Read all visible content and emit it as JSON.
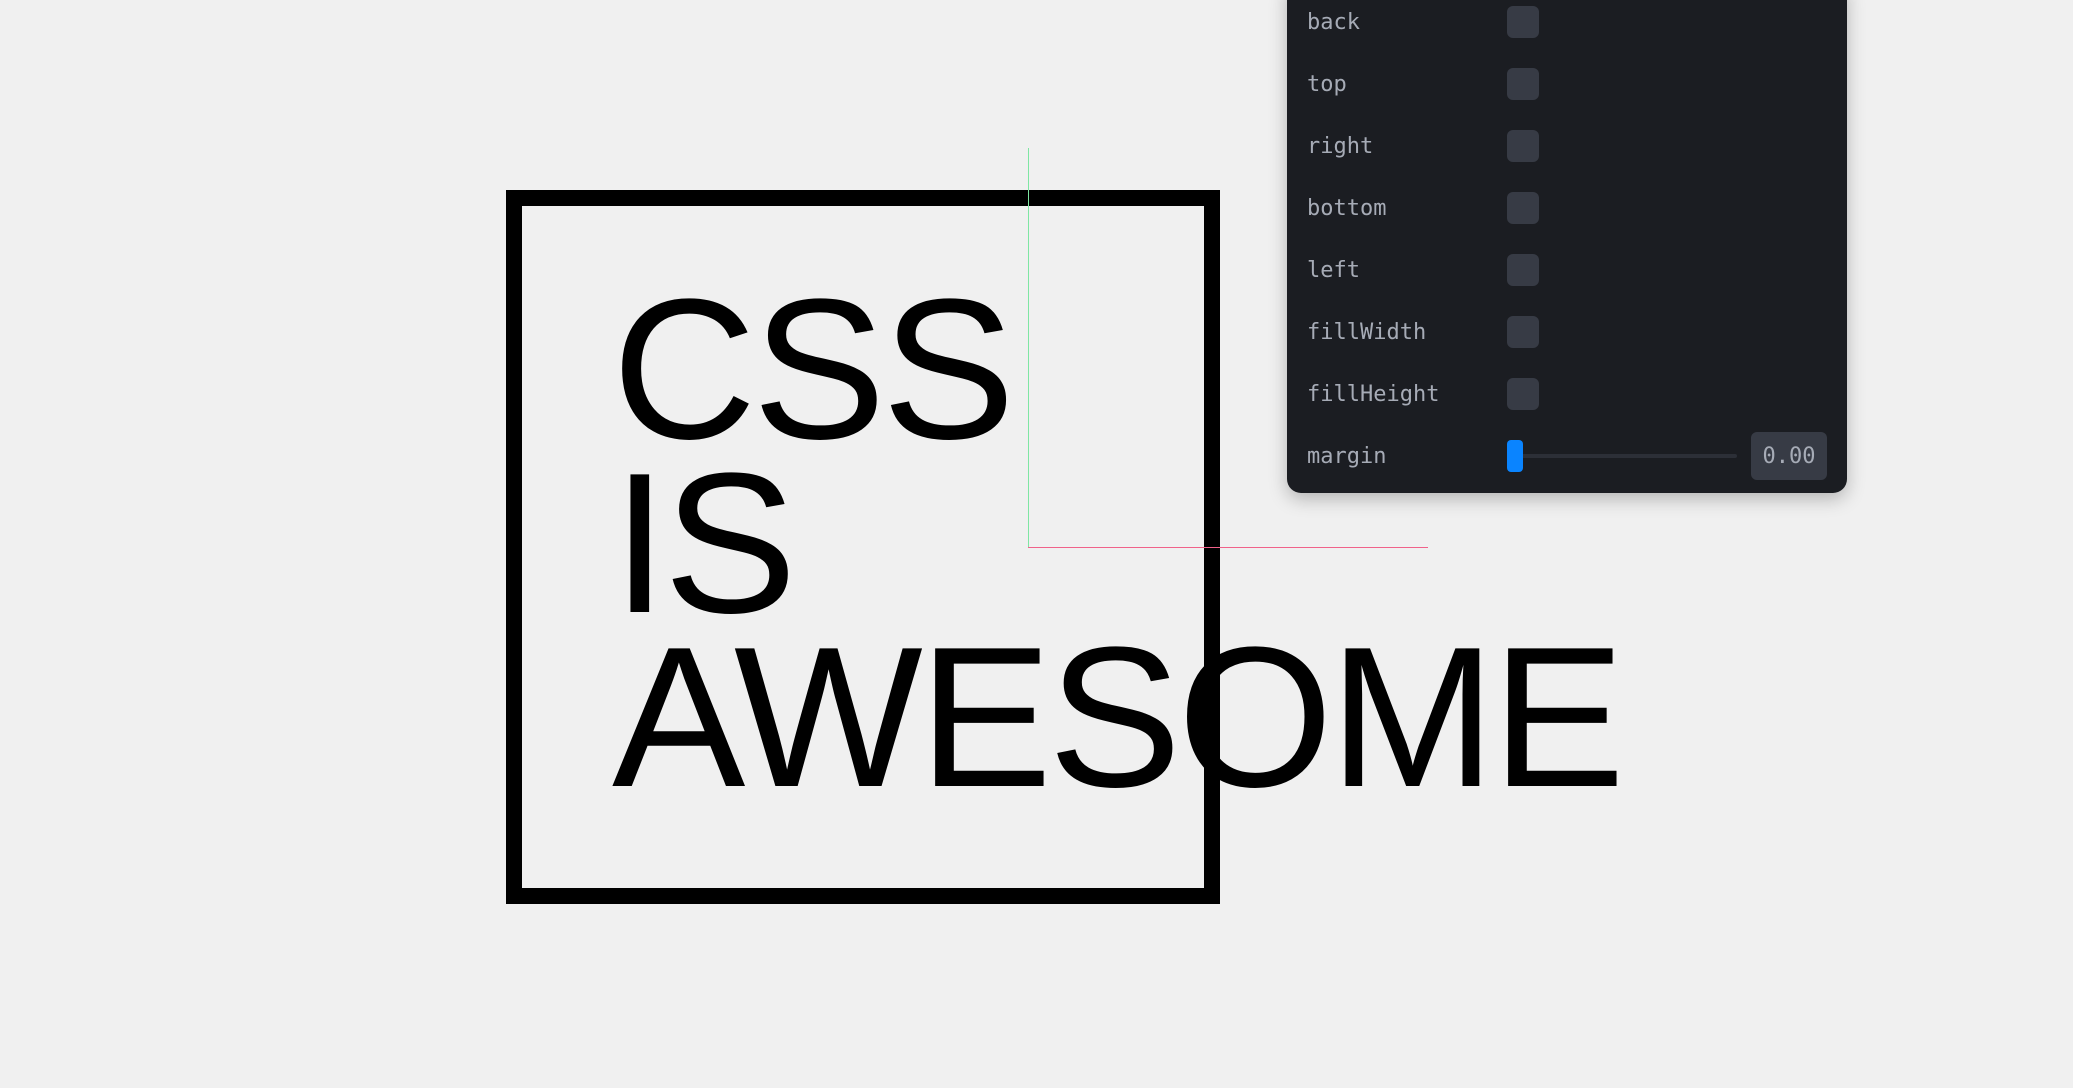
{
  "canvas": {
    "text_lines": [
      "CSS",
      "IS",
      "AWESOME"
    ],
    "colors": {
      "background": "#f0f0f0",
      "box_border": "#000000",
      "text": "#000000",
      "guide_vertical": "#7fe6a3",
      "guide_horizontal": "#f0628a"
    }
  },
  "panel": {
    "colors": {
      "background": "#1b1d22",
      "label": "#a6abb6",
      "control": "#373b45",
      "accent": "#0a84ff"
    },
    "checkbox_rows": [
      {
        "label": "back",
        "checked": false
      },
      {
        "label": "top",
        "checked": false
      },
      {
        "label": "right",
        "checked": false
      },
      {
        "label": "bottom",
        "checked": false
      },
      {
        "label": "left",
        "checked": false
      },
      {
        "label": "fillWidth",
        "checked": false
      },
      {
        "label": "fillHeight",
        "checked": false
      }
    ],
    "margin": {
      "label": "margin",
      "value": "0.00",
      "slider_fraction": 0
    }
  }
}
